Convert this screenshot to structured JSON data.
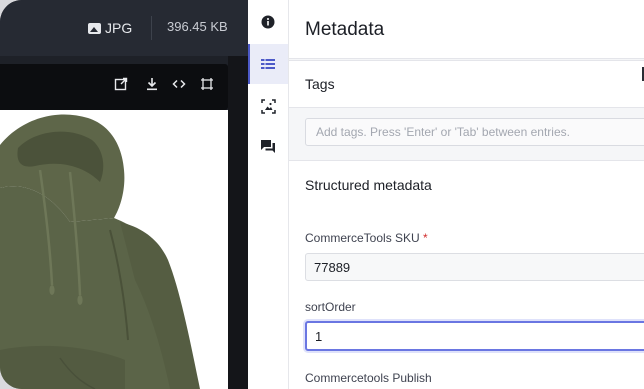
{
  "viewer": {
    "format_label": "JPG",
    "file_size": "396.45 KB"
  },
  "panel": {
    "title": "Metadata",
    "tags_label": "Tags",
    "tags_placeholder": "Add tags. Press 'Enter' or 'Tab' between entries.",
    "structured_label": "Structured metadata",
    "fields": [
      {
        "label": "CommerceTools SKU",
        "required_mark": "*",
        "value": "77889"
      },
      {
        "label": "sortOrder",
        "value": "1"
      },
      {
        "label": "Commercetools Publish"
      }
    ]
  },
  "rail": {
    "items": [
      "info-icon",
      "list-icon",
      "image-icon",
      "comments-icon"
    ],
    "active": "list-icon"
  },
  "colors": {
    "accent": "#4d5ac8",
    "viewer_bg": "#1e2128",
    "hoodie": "#5b6448"
  }
}
